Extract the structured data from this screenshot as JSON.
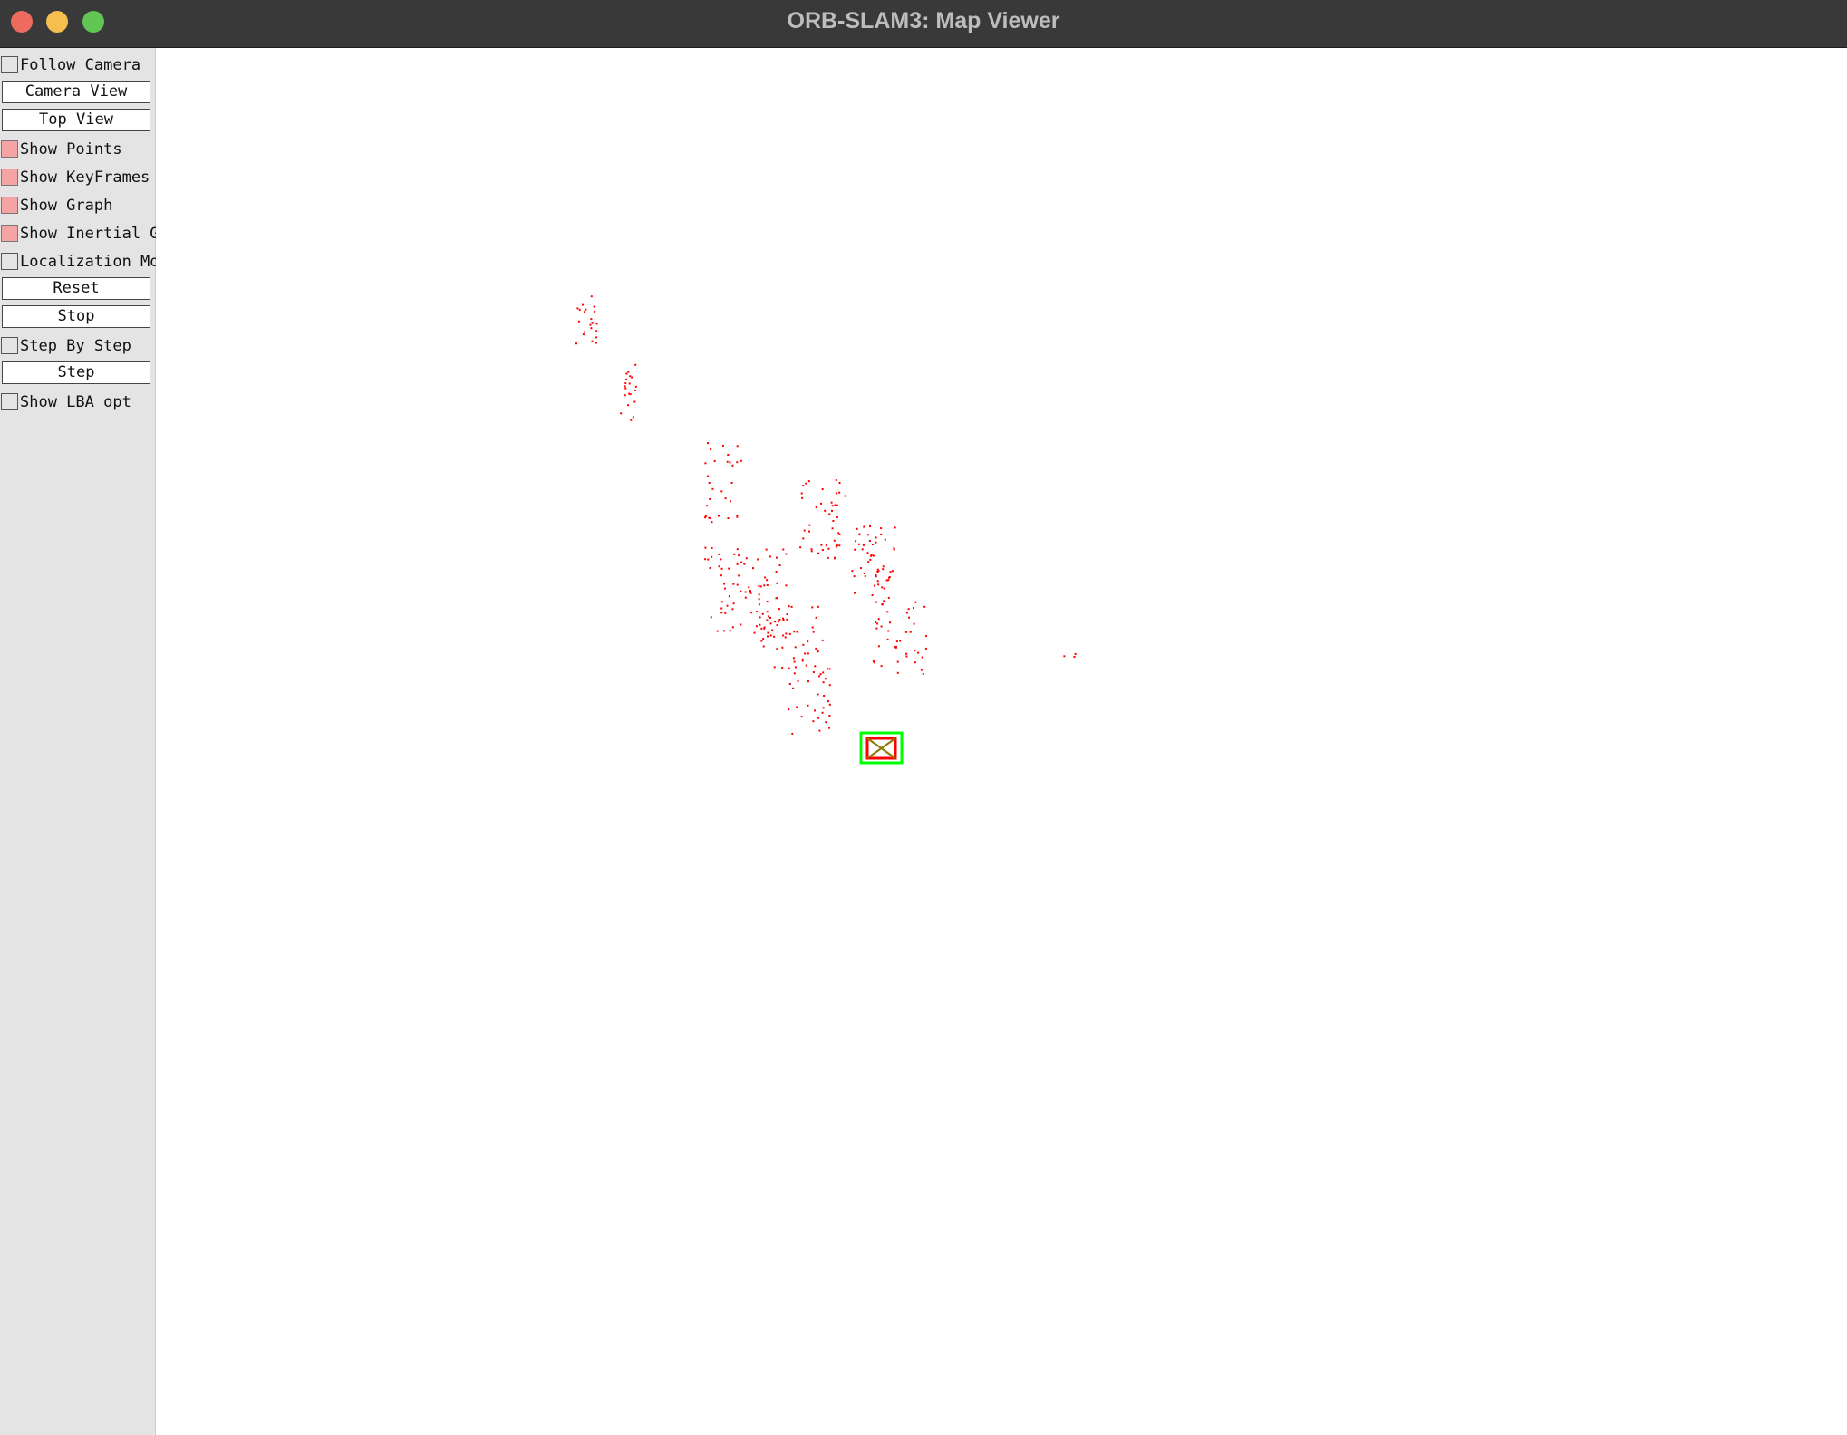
{
  "window": {
    "title": "ORB-SLAM3: Map Viewer"
  },
  "panel": {
    "follow_camera": {
      "label": "Follow Camera",
      "checked": false
    },
    "camera_view": {
      "label": "Camera View"
    },
    "top_view": {
      "label": "Top View"
    },
    "show_points": {
      "label": "Show Points",
      "checked": true
    },
    "show_keyframes": {
      "label": "Show KeyFrames",
      "checked": true
    },
    "show_graph": {
      "label": "Show Graph",
      "checked": true
    },
    "show_inertial_graph": {
      "label": "Show Inertial Graph",
      "checked": true
    },
    "localization_mode": {
      "label": "Localization Mode",
      "checked": false
    },
    "reset": {
      "label": "Reset"
    },
    "stop": {
      "label": "Stop"
    },
    "step_by_step": {
      "label": "Step By Step",
      "checked": false
    },
    "step": {
      "label": "Step"
    },
    "show_lba_opt": {
      "label": "Show LBA opt",
      "checked": false
    }
  },
  "colors": {
    "map_point": "#ff0000",
    "current_camera": "#00ff00",
    "keyframe": "#ff0000"
  }
}
